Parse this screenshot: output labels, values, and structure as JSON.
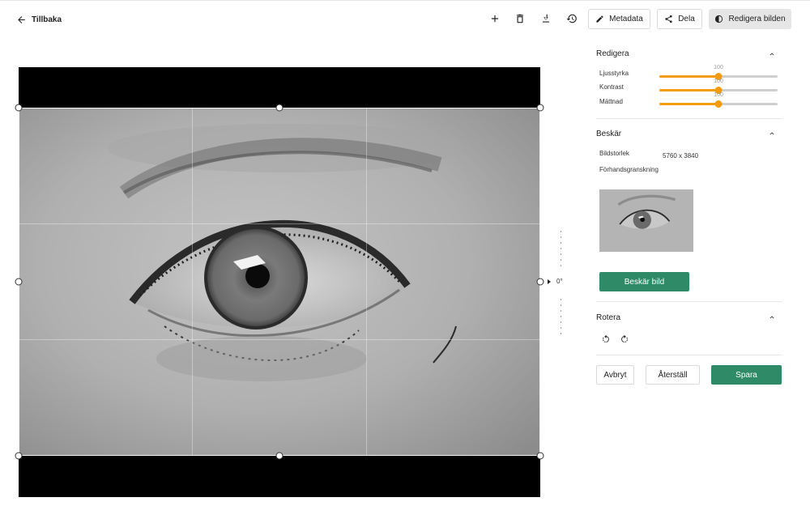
{
  "header": {
    "back_label": "Tillbaka",
    "metadata_label": "Metadata",
    "share_label": "Dela",
    "edit_label": "Redigera bilden"
  },
  "editor": {
    "rotation_label": "0°"
  },
  "panel": {
    "edit_section": {
      "title": "Redigera",
      "sliders": [
        {
          "label": "Ljusstyrka",
          "value": 100,
          "max": 200
        },
        {
          "label": "Kontrast",
          "value": 100,
          "max": 200
        },
        {
          "label": "Mättnad",
          "value": 100,
          "max": 200
        }
      ]
    },
    "crop_section": {
      "title": "Beskär",
      "size_label": "Bildstorlek",
      "size_value": "5760 x 3840",
      "preview_label": "Förhandsgranskning",
      "crop_button": "Beskär bild"
    },
    "rotate_section": {
      "title": "Rotera"
    },
    "actions": {
      "cancel": "Avbryt",
      "reset": "Återställ",
      "save": "Spara"
    }
  },
  "colors": {
    "accent_green": "#2f8a68",
    "slider_orange": "#f39c12"
  }
}
